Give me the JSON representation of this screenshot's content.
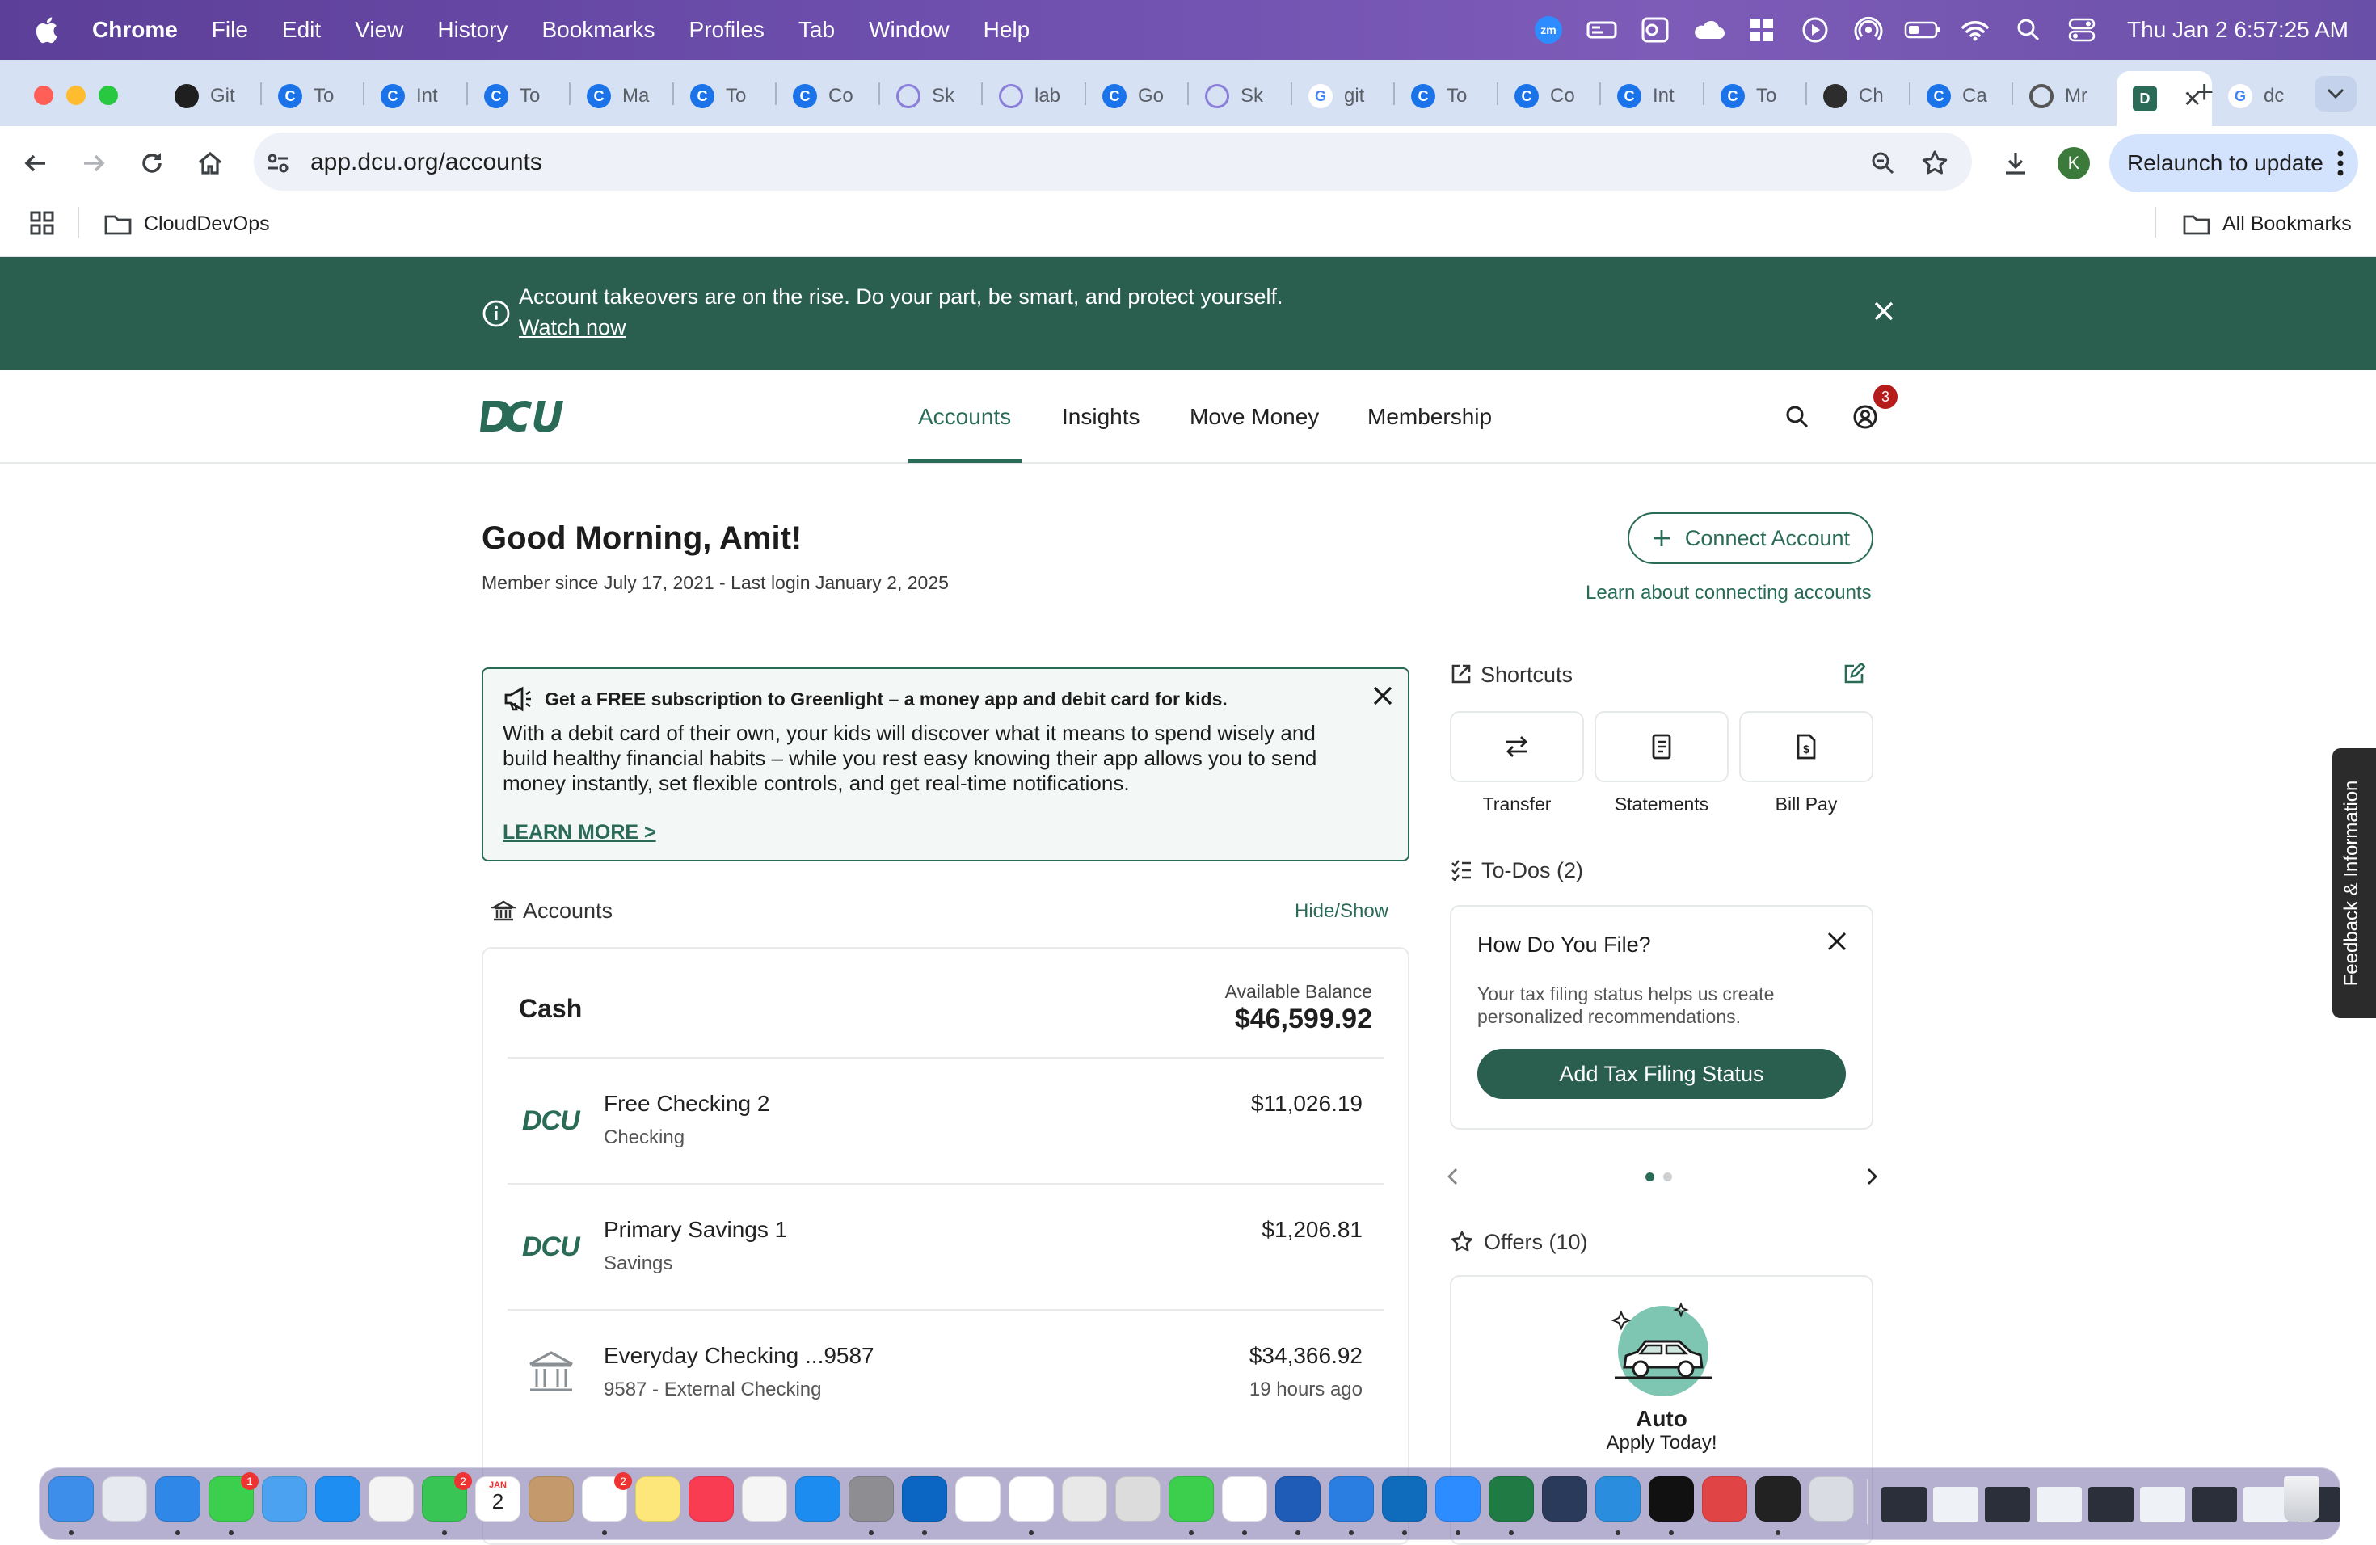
{
  "menubar": {
    "app_name": "Chrome",
    "items": [
      "File",
      "Edit",
      "View",
      "History",
      "Bookmarks",
      "Profiles",
      "Tab",
      "Window",
      "Help"
    ],
    "clock": "Thu Jan 2  6:57:25 AM"
  },
  "tabs": [
    {
      "label": "Git",
      "icon": "github-icon"
    },
    {
      "label": "To",
      "icon": "c-icon"
    },
    {
      "label": "Int",
      "icon": "c-icon"
    },
    {
      "label": "To",
      "icon": "c-icon"
    },
    {
      "label": "Ma",
      "icon": "c-icon"
    },
    {
      "label": "To",
      "icon": "c-icon"
    },
    {
      "label": "Co",
      "icon": "c-icon"
    },
    {
      "label": "Sk",
      "icon": "spark-icon"
    },
    {
      "label": "lab",
      "icon": "spark-icon"
    },
    {
      "label": "Go",
      "icon": "c-icon"
    },
    {
      "label": "Sk",
      "icon": "spark-icon"
    },
    {
      "label": "git",
      "icon": "google-icon"
    },
    {
      "label": "To",
      "icon": "c-icon"
    },
    {
      "label": "Co",
      "icon": "c-icon"
    },
    {
      "label": "Int",
      "icon": "c-icon"
    },
    {
      "label": "To",
      "icon": "c-icon"
    },
    {
      "label": "Ch",
      "icon": "openai-icon"
    },
    {
      "label": "Ca",
      "icon": "c-icon"
    },
    {
      "label": "Mr",
      "icon": "ring-icon"
    },
    {
      "label": "",
      "icon": "dcu-icon",
      "active": true
    },
    {
      "label": "dc",
      "icon": "google-icon"
    }
  ],
  "toolbar": {
    "url": "app.dcu.org/accounts",
    "relaunch_label": "Relaunch to update",
    "profile_initial": "K"
  },
  "bookmarks": {
    "folder": "CloudDevOps",
    "all": "All Bookmarks"
  },
  "alert": {
    "message": "Account takeovers are on the rise. Do your part, be smart, and protect yourself.",
    "link": "Watch now"
  },
  "nav": {
    "logo": "DCU",
    "links": [
      "Accounts",
      "Insights",
      "Move Money",
      "Membership"
    ],
    "notification_count": "3"
  },
  "greeting": {
    "title": "Good Morning, Amit!",
    "subline": "Member since July 17, 2021 - Last login January 2, 2025",
    "connect_label": "Connect Account",
    "learn_link": "Learn about connecting accounts"
  },
  "promo": {
    "title": "Get a FREE subscription to Greenlight – a money app and debit card for kids.",
    "body": "With a debit card of their own, your kids will discover what it means to spend wisely and build healthy financial habits – while you rest easy knowing their app allows you to send money instantly, set flexible controls, and get real-time notifications.",
    "link": "LEARN MORE >"
  },
  "accounts": {
    "heading": "Accounts",
    "hide_show": "Hide/Show",
    "group": "Cash",
    "available_label": "Available Balance",
    "available_value": "$46,599.92",
    "items": [
      {
        "name": "Free Checking 2",
        "type": "Checking",
        "amount": "$11,026.19",
        "logo": "DCU"
      },
      {
        "name": "Primary Savings 1",
        "type": "Savings",
        "amount": "$1,206.81",
        "logo": "DCU"
      },
      {
        "name": "Everyday Checking ...9587",
        "type": "9587 - External Checking",
        "amount": "$34,366.92",
        "time": "19 hours ago"
      }
    ]
  },
  "shortcuts": {
    "heading": "Shortcuts",
    "items": [
      "Transfer",
      "Statements",
      "Bill Pay"
    ]
  },
  "todos": {
    "heading": "To-Dos (2)",
    "title": "How Do You File?",
    "description": "Your tax filing status helps us create personalized recommendations.",
    "button": "Add Tax Filing Status",
    "page_count": 2,
    "current_page": 1
  },
  "offers": {
    "heading": "Offers (10)",
    "title": "Auto",
    "subtitle": "Apply Today!"
  },
  "feedback": "Feedback & Information",
  "dock": {
    "calendar_month": "JAN",
    "calendar_day": "2",
    "badges": {
      "messages": "1",
      "facetime": "2",
      "reminders": "2"
    }
  },
  "colors": {
    "brand_green": "#2a6b58",
    "banner_green": "#2a5f4f",
    "menubar_purple": "#6e4fae"
  }
}
